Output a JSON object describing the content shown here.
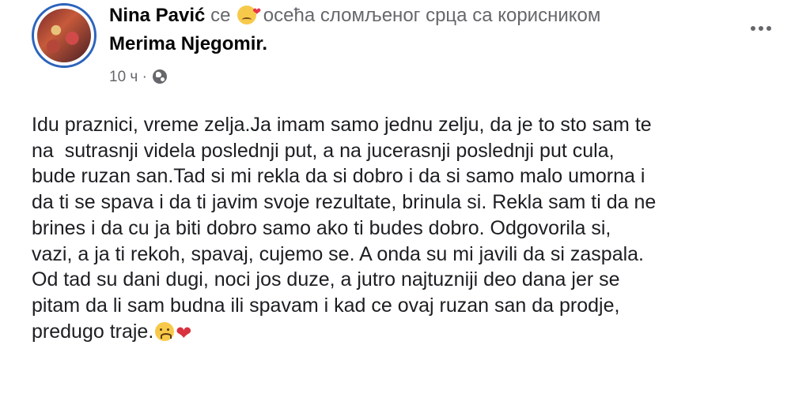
{
  "post": {
    "author": "Nina Pavić",
    "activity_prefix": "се",
    "activity_text": "осећа сломљеног срца са корисником",
    "tagged_user": "Merima Njegomir",
    "tagged_suffix": ".",
    "timestamp": "10 ч",
    "separator": "·",
    "audience_icon": "globe-icon",
    "feeling_icon": "broken-heart-face-emoji",
    "body_lines": [
      "Idu praznici, vreme zelja.Ja imam samo jednu zelju, da je to sto sam te",
      "na  sutrasnji videla poslednji put, a na jucerasnji poslednji put cula,",
      "bude ruzan san.Tad si mi rekla da si dobro i da si samo malo umorna i",
      "da ti se spava i da ti javim svoje rezultate, brinula si. Rekla sam ti da ne",
      "brines i da cu ja biti dobro samo ako ti budes dobro. Odgovorila si,",
      "vazi, a ja ti rekoh, spavaj, cujemo se. A onda su mi javili da si zaspala.",
      "Od tad su dani dugi, noci jos duze, a jutro najtuzniji deo dana jer se",
      "pitam da li sam budna ili spavam i kad ce ovaj ruzan san da prodje,",
      "predugo traje."
    ],
    "end_emojis": [
      "sad-face-emoji",
      "broken-heart-icon"
    ],
    "more_icon": "more-options-icon",
    "colors": {
      "author": "#050505",
      "secondary_text": "#65676b",
      "avatar_ring": "#2d64bc",
      "heart": "#d8333f"
    }
  }
}
